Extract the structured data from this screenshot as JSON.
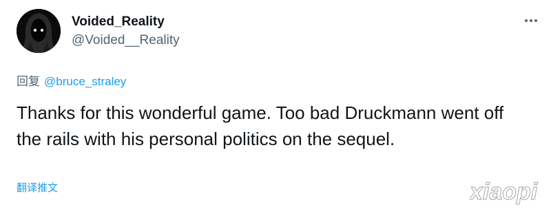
{
  "tweet": {
    "author": {
      "display_name": "Voided_Reality",
      "handle": "@Voided__Reality",
      "avatar_icon": "hooded-figure-avatar"
    },
    "more_icon": "more-dots-icon",
    "reply": {
      "prefix": "回复",
      "mention": "@bruce_straley"
    },
    "text": "Thanks for this wonderful game. Too bad Druckmann went off the rails with his personal politics on the sequel.",
    "translate_label": "翻译推文"
  },
  "watermark_text": "xiaopi",
  "colors": {
    "text_primary": "#0f1419",
    "text_secondary": "#536471",
    "link": "#1d9bf0",
    "background": "#ffffff"
  }
}
